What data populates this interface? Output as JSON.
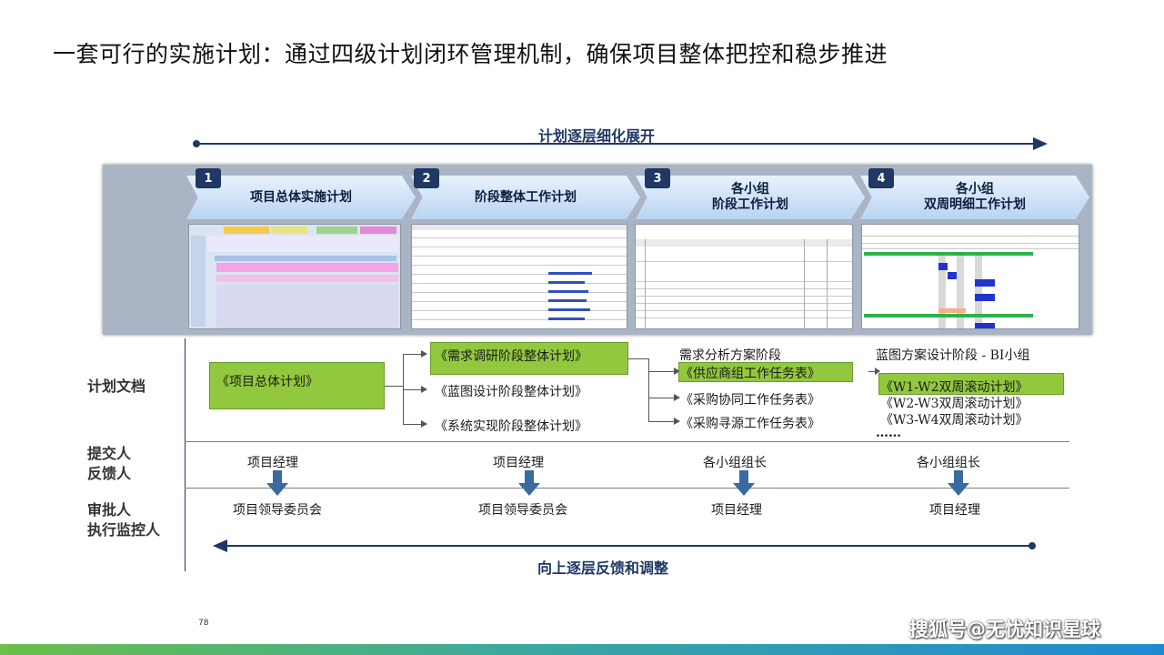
{
  "title": "一套可行的实施计划：通过四级计划闭环管理机制，确保项目整体把控和稳步推进",
  "top_arrow_label": "计划逐层细化展开",
  "bottom_arrow_label": "向上逐层反馈和调整",
  "stages": [
    {
      "num": "1",
      "label": "项目总体实施计划"
    },
    {
      "num": "2",
      "label": "阶段整体工作计划"
    },
    {
      "num": "3",
      "label": "各小组\n阶段工作计划"
    },
    {
      "num": "4",
      "label": "各小组\n双周明细工作计划"
    }
  ],
  "row_labels": {
    "docs": "计划文档",
    "submitter": "提交人\n反馈人",
    "approver": "审批人\n执行监控人"
  },
  "docs": {
    "col1": "《项目总体计划》",
    "col2": [
      "《需求调研阶段整体计划》",
      "《蓝图设计阶段整体计划》",
      "《系统实现阶段整体计划》"
    ],
    "col3_header": "需求分析方案阶段",
    "col3": [
      "《供应商组工作任务表》",
      "《采购协同工作任务表》",
      "《采购寻源工作任务表》"
    ],
    "col4_header": "蓝图方案设计阶段 - BI小组",
    "col4": [
      "《W1-W2双周滚动计划》",
      "《W2-W3双周滚动计划》",
      "《W3-W4双周滚动计划》"
    ],
    "col4_more": "……"
  },
  "submitters": [
    "项目经理",
    "项目经理",
    "各小组组长",
    "各小组组长"
  ],
  "approvers": [
    "项目领导委员会",
    "项目领导委员会",
    "项目经理",
    "项目经理"
  ],
  "page_number": "78",
  "watermark": "搜狐号@无忧知识星球",
  "colors": {
    "navy": "#1f3864",
    "green_box": "#92c83e",
    "chevron": "#b9d4f1"
  }
}
